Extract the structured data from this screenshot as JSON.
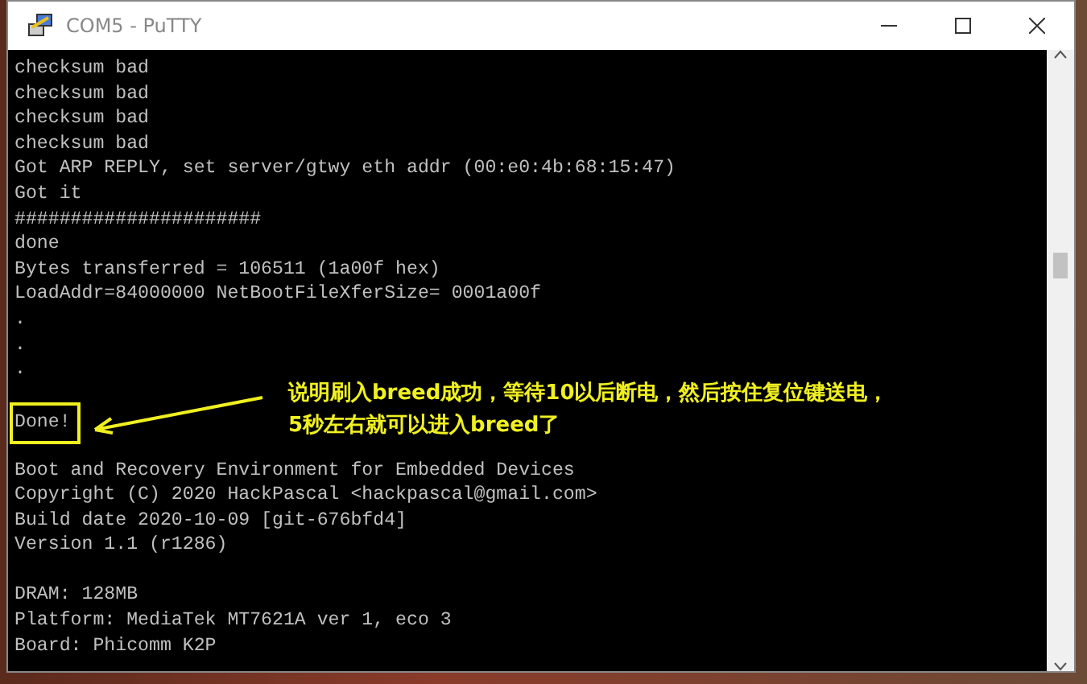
{
  "window": {
    "title": "COM5 - PuTTY"
  },
  "terminal": {
    "lines": [
      {
        "kind": "text",
        "text": "checksum bad"
      },
      {
        "kind": "text",
        "text": "checksum bad"
      },
      {
        "kind": "text",
        "text": "checksum bad"
      },
      {
        "kind": "text",
        "text": "checksum bad"
      },
      {
        "kind": "text",
        "text": "Got ARP REPLY, set server/gtwy eth addr (00:e0:4b:68:15:47)"
      },
      {
        "kind": "text",
        "text": "Got it"
      },
      {
        "kind": "text",
        "text": "######################"
      },
      {
        "kind": "text",
        "text": "done"
      },
      {
        "kind": "text",
        "text": "Bytes transferred = 106511 (1a00f hex)"
      },
      {
        "kind": "text",
        "text": "LoadAddr=84000000 NetBootFileXferSize= 0001a00f"
      },
      {
        "kind": "text",
        "text": "."
      },
      {
        "kind": "text",
        "text": "."
      },
      {
        "kind": "text",
        "text": "."
      },
      {
        "kind": "blank"
      },
      {
        "kind": "highlighted",
        "text": "Done!"
      },
      {
        "kind": "blank"
      },
      {
        "kind": "text",
        "text": "Boot and Recovery Environment for Embedded Devices"
      },
      {
        "kind": "text",
        "text": "Copyright (C) 2020 HackPascal <hackpascal@gmail.com>"
      },
      {
        "kind": "text",
        "text": "Build date 2020-10-09 [git-676bfd4]"
      },
      {
        "kind": "text",
        "text": "Version 1.1 (r1286)"
      },
      {
        "kind": "blank"
      },
      {
        "kind": "text",
        "text": "DRAM: 128MB"
      },
      {
        "kind": "text",
        "text": "Platform: MediaTek MT7621A ver 1, eco 3"
      },
      {
        "kind": "text",
        "text": "Board: Phicomm K2P"
      }
    ]
  },
  "annotation": {
    "lines": [
      "说明刷入breed成功，等待10以后断电，然后按住复位键送电，",
      "5秒左右就可以进入breed了"
    ]
  }
}
